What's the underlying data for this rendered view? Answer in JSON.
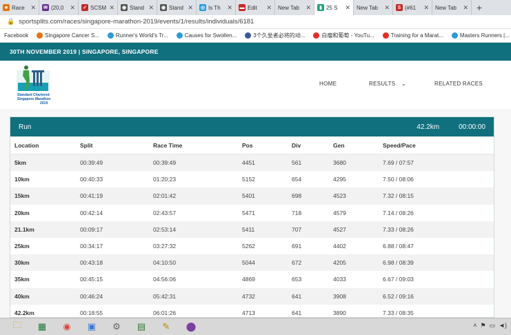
{
  "browser": {
    "tabs": [
      {
        "title": "Race",
        "fav_color": "#e8730e",
        "glyph": "■",
        "active": false
      },
      {
        "title": "(20,0",
        "fav_color": "#6a2d8f",
        "glyph": "✉",
        "active": false
      },
      {
        "title": "SCSM",
        "fav_color": "#c62828",
        "glyph": "✓",
        "active": false
      },
      {
        "title": "Stand",
        "fav_color": "#555555",
        "glyph": "◉",
        "active": false
      },
      {
        "title": "Stand",
        "fav_color": "#555555",
        "glyph": "◉",
        "active": false
      },
      {
        "title": "Is Th",
        "fav_color": "#2b9ad8",
        "glyph": "◎",
        "active": false
      },
      {
        "title": "Edit",
        "fav_color": "#c62828",
        "glyph": "▬",
        "active": false
      },
      {
        "title": "New Tab",
        "fav_color": "",
        "glyph": "",
        "active": false
      },
      {
        "title": "25 S",
        "fav_color": "#1aa37a",
        "glyph": "▮",
        "active": true
      },
      {
        "title": "New Tab",
        "fav_color": "",
        "glyph": "",
        "active": false
      },
      {
        "title": "(#61",
        "fav_color": "#c62828",
        "glyph": "S",
        "active": false
      },
      {
        "title": "New Tab",
        "fav_color": "",
        "glyph": "",
        "active": false
      }
    ],
    "tab_close": "✕",
    "new_tab_symbol": "+",
    "address": "sportsplits.com/races/singapore-marathon-2019/events/1/results/individuals/6181",
    "bookmarks": [
      {
        "label": "Facebook",
        "icon_color": ""
      },
      {
        "label": "Singapore Cancer S...",
        "icon_color": "#e8730e"
      },
      {
        "label": "Runner's World's Tr...",
        "icon_color": "#2b9ad8"
      },
      {
        "label": "Causes for Swollen...",
        "icon_color": "#2b9ad8"
      },
      {
        "label": "3个久坐者必将的动...",
        "icon_color": "#3b5998"
      },
      {
        "label": "白瘤和葡萄 - YouTu...",
        "icon_color": "#e52d27"
      },
      {
        "label": "Training for a Marat...",
        "icon_color": "#e52d27"
      },
      {
        "label": "Masters Runners |...",
        "icon_color": "#2b9ad8"
      }
    ]
  },
  "site": {
    "banner": "30TH NOVEMBER 2019 | SINGAPORE, SINGAPORE",
    "logo_lines": [
      "Standard Chartered",
      "Singapore Marathon",
      "2019"
    ],
    "nav": {
      "home": "HOME",
      "results": "RESULTS",
      "related": "RELATED RACES"
    }
  },
  "results": {
    "title": "Run",
    "distance": "42.2km",
    "time": "00:00:00",
    "columns": [
      "Location",
      "Split",
      "Race Time",
      "Pos",
      "Div",
      "Gen",
      "Speed/Pace"
    ],
    "rows": [
      [
        "5km",
        "00:39:49",
        "00:39:49",
        "4451",
        "561",
        "3680",
        "7.69 / 07:57"
      ],
      [
        "10km",
        "00:40:33",
        "01:20:23",
        "5152",
        "654",
        "4295",
        "7.50 / 08:06"
      ],
      [
        "15km",
        "00:41:19",
        "02:01:42",
        "5401",
        "698",
        "4523",
        "7.32 / 08:15"
      ],
      [
        "20km",
        "00:42:14",
        "02:43:57",
        "5471",
        "718",
        "4579",
        "7.14 / 08:26"
      ],
      [
        "21.1km",
        "00:09:17",
        "02:53:14",
        "5411",
        "707",
        "4527",
        "7.33 / 08:26"
      ],
      [
        "25km",
        "00:34:17",
        "03:27:32",
        "5262",
        "691",
        "4402",
        "6.88 / 08:47"
      ],
      [
        "30km",
        "00:43:18",
        "04:10:50",
        "5044",
        "672",
        "4205",
        "6.98 / 08:39"
      ],
      [
        "35km",
        "00:45:15",
        "04:56:06",
        "4869",
        "653",
        "4033",
        "6.67 / 09:03"
      ],
      [
        "40km",
        "00:46:24",
        "05:42:31",
        "4732",
        "641",
        "3908",
        "6.52 / 09:16"
      ],
      [
        "42.2km",
        "00:18:55",
        "06:01:26",
        "4713",
        "641",
        "3890",
        "7.33 / 08:35"
      ]
    ]
  }
}
